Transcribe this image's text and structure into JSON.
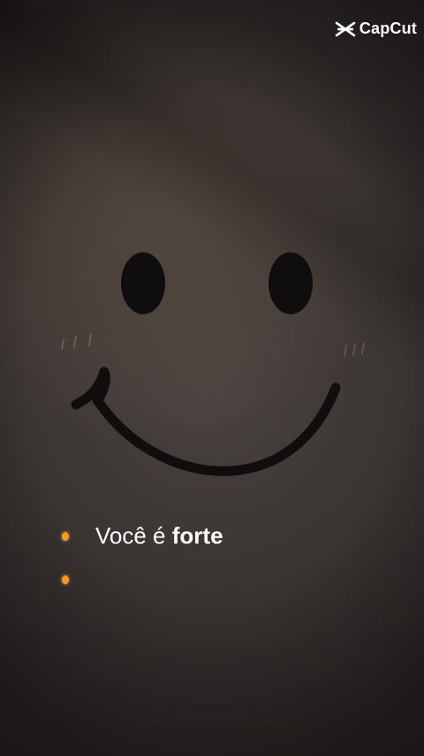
{
  "watermark": {
    "brand_name": "CapCut",
    "icon": "capcut-logo-icon",
    "color": "#ffffff"
  },
  "caption": {
    "lines": [
      {
        "normal_text": "Você é",
        "bold_text": "forte"
      },
      {
        "normal_text": "",
        "bold_text": ""
      }
    ],
    "bullet_color": "#f39a2a"
  },
  "background": {
    "image": "smiley-face-drawing",
    "base_color": "#2f2a29"
  }
}
